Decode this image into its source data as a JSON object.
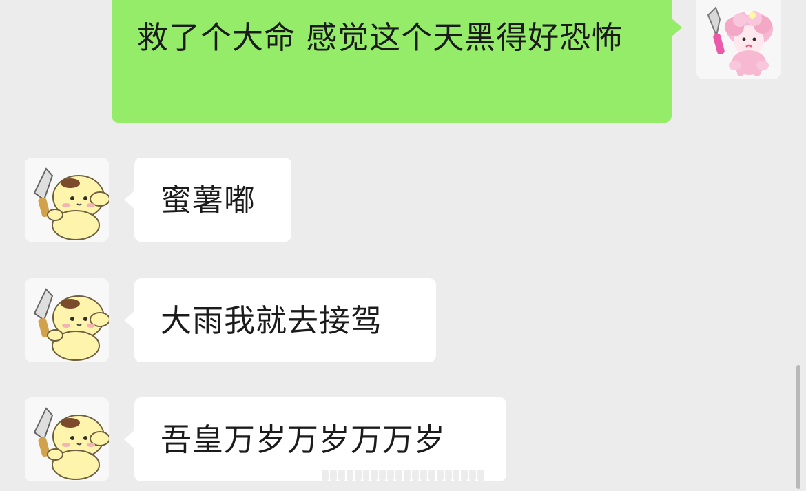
{
  "chat": {
    "messages": [
      {
        "id": "m1",
        "sender": "self",
        "text": "救了个大命 感觉这个天黑得好恐怖"
      },
      {
        "id": "m2",
        "sender": "other",
        "text": "蜜薯嘟"
      },
      {
        "id": "m3",
        "sender": "other",
        "text": "大雨我就去接驾"
      },
      {
        "id": "m4",
        "sender": "other",
        "text": "吾皇万岁万岁万万岁"
      }
    ]
  },
  "avatars": {
    "self": "pink-sheep-knife-avatar-icon",
    "other": "yellow-puppy-knife-avatar-icon"
  },
  "colors": {
    "background": "#ececec",
    "self_bubble": "#95ec69",
    "other_bubble": "#ffffff"
  }
}
